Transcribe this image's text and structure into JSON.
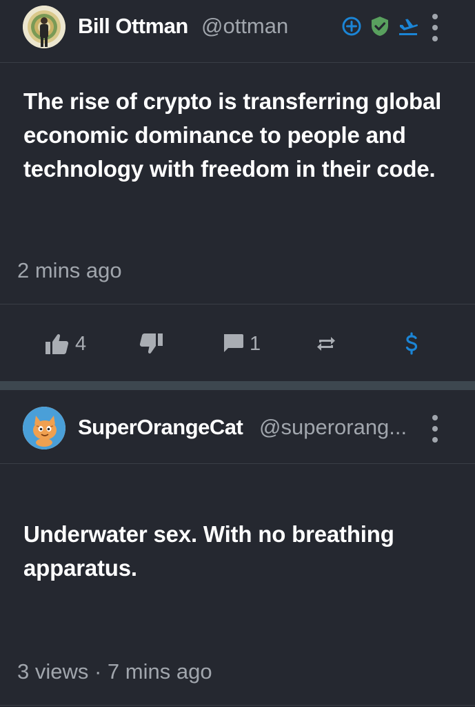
{
  "posts": [
    {
      "author": {
        "name": "Bill Ottman",
        "handle": "@ottman",
        "badges": [
          "plus-circle-icon",
          "verified-shield-icon",
          "boost-plane-icon"
        ]
      },
      "text": "The rise of crypto is transferring global economic dominance to people and technology with freedom in their code.",
      "meta": "2 mins ago",
      "actions": {
        "upvotes": "4",
        "comments": "1"
      }
    },
    {
      "author": {
        "name": "SuperOrangeCat",
        "handle": "@superorang..."
      },
      "text": "Underwater sex. With no breathing apparatus.",
      "meta": "3 views · 7 mins ago"
    }
  ],
  "colors": {
    "background": "#252830",
    "accent_blue": "#1b85d6",
    "verified_green": "#59a05e",
    "muted_text": "#a1a6ad"
  }
}
